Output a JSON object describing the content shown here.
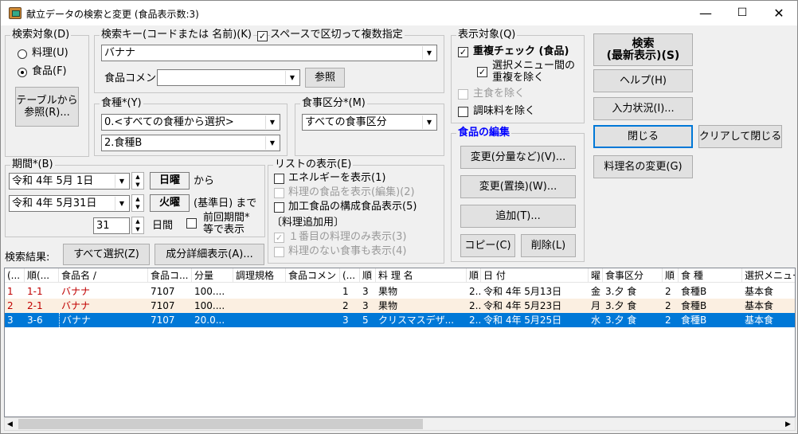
{
  "window": {
    "title": "献立データの検索と変更 (食品表示数:3)",
    "minimize": "—",
    "maximize": "☐",
    "close": "✕"
  },
  "search_target": {
    "label": "検索対象(D)",
    "options": [
      {
        "label": "料理(U)",
        "selected": false
      },
      {
        "label": "食品(F)",
        "selected": true
      }
    ],
    "table_ref_button": "テーブルから\n参照(R)..."
  },
  "search_key": {
    "label": "検索キー(コードまたは 名前)(K)",
    "multi_label": "スペースで区切って複数指定",
    "multi_checked": true,
    "value": "バナナ",
    "comment_label": "食品コメント",
    "comment_value": "",
    "ref_button": "参照"
  },
  "food_type": {
    "label": "食種*(Y)",
    "value1": "0.<すべての食種から選択>",
    "value2": "2.食種B"
  },
  "meal_class": {
    "label": "食事区分*(M)",
    "value": "すべての食事区分"
  },
  "period": {
    "label": "期間*(B)",
    "from_date": "令和  4年  5月  1日",
    "from_day": "日曜",
    "from_suffix": "から",
    "to_date": "令和  4年  5月31日",
    "to_day": "火曜",
    "to_suffix": "(基準日) まで",
    "days": "31",
    "days_unit": "日間",
    "prev_label": "前回期間*",
    "prev_label2": "等で表示"
  },
  "display_target": {
    "label": "表示対象(Q)",
    "dup_check": "重複チェック (食品)",
    "dup_checked": true,
    "excl_menu": "選択メニュー間の",
    "excl_menu2": "重複を除く",
    "excl_menu_checked": true,
    "excl_staple": "主食を除く",
    "excl_seasoning": "調味料を除く"
  },
  "list_display": {
    "label": "リストの表示(E)",
    "energy": "エネルギーを表示(1)",
    "dish_food": "料理の食品を表示(編集)(2)",
    "processed": "加工食品の構成食品表示(5)",
    "dish_add_label": "〔料理追加用〕",
    "first_only": "１番目の料理のみ表示(3)",
    "no_dish": "料理のない食事も表示(4)"
  },
  "food_edit": {
    "label": "食品の編集",
    "change_qty": "変更(分量など)(V)...",
    "change_replace": "変更(置換)(W)...",
    "add": "追加(T)...",
    "copy": "コピー(C)",
    "delete": "削除(L)"
  },
  "buttons": {
    "search": "検索\n(最新表示)(S)",
    "help": "ヘルプ(H)",
    "input_status": "入力状況(I)...",
    "close": "閉じる",
    "clear_close": "クリアして閉じる",
    "rename": "料理名の変更(G)"
  },
  "results": {
    "label": "検索結果:",
    "select_all": "すべて選択(Z)",
    "detail": "成分詳細表示(A)..."
  },
  "table": {
    "headers": [
      "(...",
      "順(...",
      "食品名 /",
      "食品コ...",
      "分量",
      "調理規格",
      "食品コメント",
      "(...",
      "順",
      "料 理 名",
      "順",
      "日  付",
      "曜",
      "食事区分",
      "順",
      "食  種",
      "選択メニュー"
    ],
    "rows": [
      [
        "1",
        "1-1",
        "バナナ",
        "7107",
        "100....",
        "",
        "",
        "1",
        "3",
        "果物",
        "2...",
        "令和 4年 5月13日",
        "金",
        "3.夕 食",
        "2",
        "食種B",
        "基本食"
      ],
      [
        "2",
        "2-1",
        "バナナ",
        "7107",
        "100....",
        "",
        "",
        "2",
        "3",
        "果物",
        "2...",
        "令和 4年 5月23日",
        "月",
        "3.夕 食",
        "2",
        "食種B",
        "基本食"
      ],
      [
        "3",
        "3-6",
        "バナナ",
        "7107",
        "20.0...",
        "",
        "",
        "3",
        "5",
        "クリスマスデザ...",
        "2...",
        "令和 4年 5月25日",
        "水",
        "3.夕 食",
        "2",
        "食種B",
        "基本食"
      ]
    ]
  },
  "colors": {
    "selected_row": "#0078d7",
    "row_red": "#c00000",
    "row2_bg": "#fbefe1",
    "edit_title": "#0000ff"
  }
}
